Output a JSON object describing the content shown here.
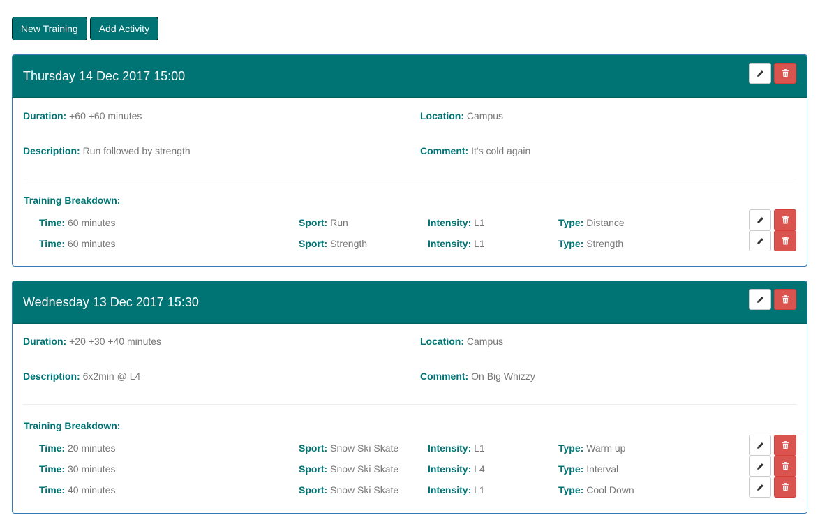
{
  "toolbar": {
    "new_training_label": "New Training",
    "add_activity_label": "Add Activity"
  },
  "labels": {
    "duration": "Duration:",
    "location": "Location:",
    "description": "Description:",
    "comment": "Comment:",
    "breakdown": "Training Breakdown:",
    "time": "Time:",
    "sport": "Sport:",
    "intensity": "Intensity:",
    "type": "Type:"
  },
  "icons": {
    "edit": "pencil-icon",
    "delete": "trash-icon"
  },
  "colors": {
    "brand": "#007474",
    "danger": "#d9534f",
    "panel_border": "#337ab7",
    "text": "#777777"
  },
  "trainings": [
    {
      "title": "Thursday 14 Dec 2017 15:00",
      "duration": "+60 +60 minutes",
      "location": "Campus",
      "description": "Run followed by strength",
      "comment": "It's cold again",
      "activities": [
        {
          "time": "60 minutes",
          "sport": "Run",
          "intensity": "L1",
          "type": "Distance"
        },
        {
          "time": "60 minutes",
          "sport": "Strength",
          "intensity": "L1",
          "type": "Strength"
        }
      ]
    },
    {
      "title": "Wednesday 13 Dec 2017 15:30",
      "duration": "+20 +30 +40 minutes",
      "location": "Campus",
      "description": "6x2min @ L4",
      "comment": "On Big Whizzy",
      "activities": [
        {
          "time": "20 minutes",
          "sport": "Snow Ski Skate",
          "intensity": "L1",
          "type": "Warm up"
        },
        {
          "time": "30 minutes",
          "sport": "Snow Ski Skate",
          "intensity": "L4",
          "type": "Interval"
        },
        {
          "time": "40 minutes",
          "sport": "Snow Ski Skate",
          "intensity": "L1",
          "type": "Cool Down"
        }
      ]
    }
  ]
}
